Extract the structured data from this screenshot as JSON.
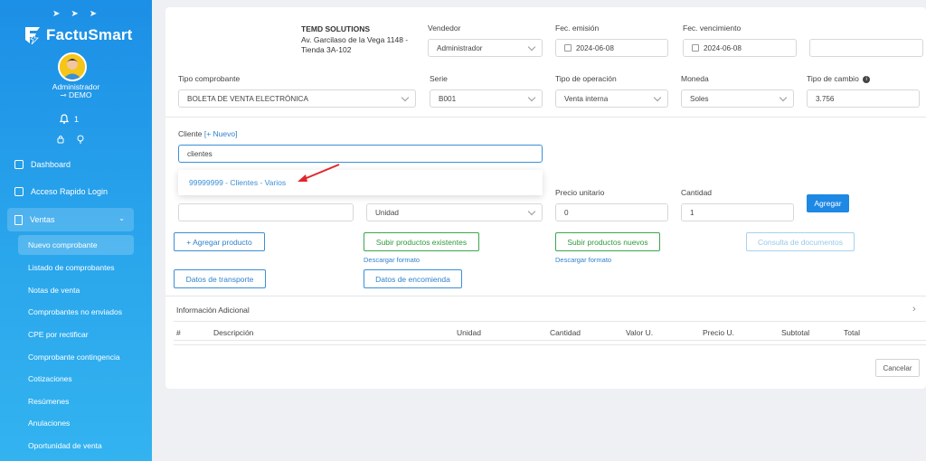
{
  "brand": {
    "name": "FactuSmart"
  },
  "user": {
    "name": "Administrador",
    "role": "DEMO"
  },
  "notifications": {
    "count": "1"
  },
  "sidebar": {
    "items": [
      {
        "label": "Dashboard",
        "icon": "store-icon"
      },
      {
        "label": "Acceso Rapido Login",
        "icon": "external-link-icon"
      }
    ],
    "group": {
      "label": "Ventas",
      "icon": "document-icon",
      "expanded": true
    },
    "sub_items": [
      "Nuevo comprobante",
      "Listado de comprobantes",
      "Notas de venta",
      "Comprobantes no enviados",
      "CPE por rectificar",
      "Comprobante contingencia",
      "Cotizaciones",
      "Resúmenes",
      "Anulaciones",
      "Oportunidad de venta"
    ]
  },
  "company": {
    "name": "TEMD SOLUTIONS",
    "address_line1": "Av. Garcilaso de la Vega 1148 -",
    "address_line2": "Tienda 3A-102"
  },
  "form": {
    "vendedor": {
      "label": "Vendedor",
      "value": "Administrador"
    },
    "fec_emision": {
      "label": "Fec. emisión",
      "value": "2024-06-08"
    },
    "fec_vencimiento": {
      "label": "Fec. vencimiento",
      "value": "2024-06-08"
    },
    "tipo_comprobante": {
      "label": "Tipo comprobante",
      "value": "BOLETA DE VENTA ELECTRÓNICA"
    },
    "serie": {
      "label": "Serie",
      "value": "B001"
    },
    "tipo_operacion": {
      "label": "Tipo de operación",
      "value": "Venta interna"
    },
    "moneda": {
      "label": "Moneda",
      "value": "Soles"
    },
    "tipo_cambio": {
      "label": "Tipo de cambio",
      "value": "3.756"
    },
    "cliente": {
      "label": "Cliente",
      "new_link": "[+ Nuevo]",
      "value": "clientes"
    },
    "cliente_option": "99999999 - Clientes - Varios",
    "unidad": {
      "value": "Unidad"
    },
    "precio_unitario": {
      "label": "Precio unitario",
      "value": "0"
    },
    "cantidad": {
      "label": "Cantidad",
      "value": "1"
    }
  },
  "buttons": {
    "agregar": "Agregar",
    "agregar_producto": "+ Agregar producto",
    "subir_existentes": "Subir productos existentes",
    "subir_nuevos": "Subir productos nuevos",
    "consulta_documentos": "Consulta de documentos",
    "datos_transporte": "Datos de transporte",
    "datos_encomienda": "Datos de encomienda",
    "cancelar": "Cancelar"
  },
  "links": {
    "descargar_formato": "Descargar formato"
  },
  "info_adicional": "Información Adicional",
  "table": {
    "headers": [
      "#",
      "Descripción",
      "Unidad",
      "Cantidad",
      "Valor U.",
      "Precio U.",
      "Subtotal",
      "Total"
    ]
  },
  "colors": {
    "sidebar_top": "#1c8fe6",
    "sidebar_bottom": "#33b3f0",
    "accent": "#1e88e5",
    "success": "#3aa84b",
    "arrow": "#e0262b"
  }
}
